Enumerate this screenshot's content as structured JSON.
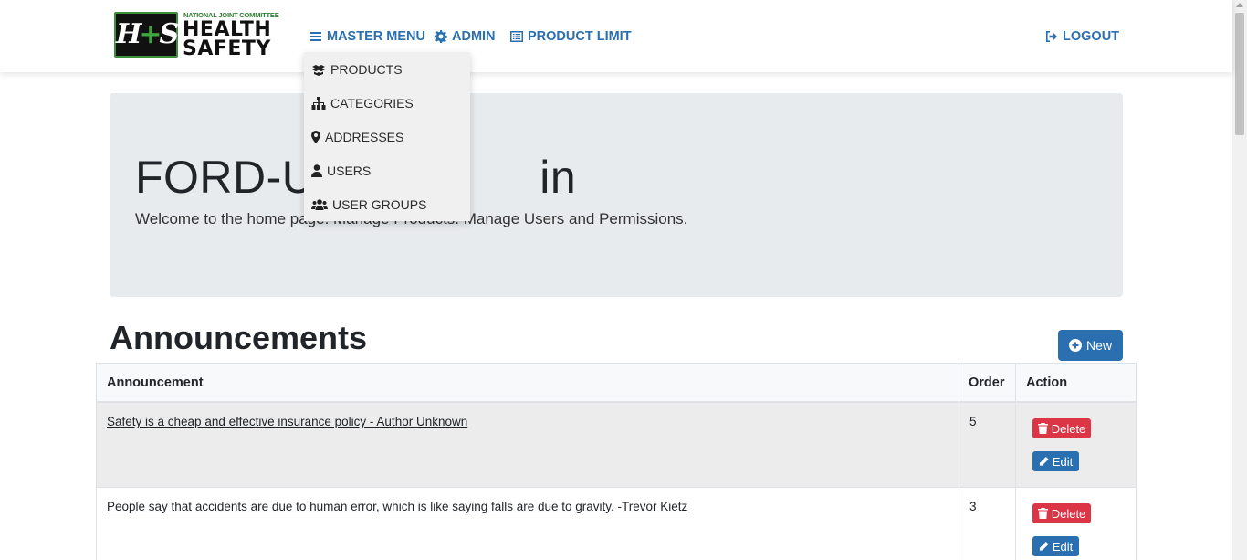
{
  "logo": {
    "small_text": "NATIONAL JOINT COMMITTEE",
    "mark_h": "H",
    "mark_plus": "+",
    "mark_s": "S",
    "line1": "HEALTH",
    "line2": "SAFETY"
  },
  "nav": {
    "master_menu": "MASTER MENU",
    "admin": "ADMIN",
    "product_limit": "PRODUCT LIMIT",
    "logout": "LOGOUT",
    "icons": {
      "master_menu": "bars-icon",
      "admin": "gear-icon",
      "product_limit": "list-alt-icon",
      "logout": "sign-out-icon"
    }
  },
  "dropdown": {
    "items": [
      {
        "label": "PRODUCTS",
        "icon": "boxes-icon"
      },
      {
        "label": "CATEGORIES",
        "icon": "sitemap-icon"
      },
      {
        "label": "ADDRESSES",
        "icon": "map-marker-icon"
      },
      {
        "label": "USERS",
        "icon": "user-icon"
      },
      {
        "label": "USER GROUPS",
        "icon": "users-icon"
      }
    ]
  },
  "jumbotron": {
    "title": "FORD-UA",
    "title_visible_end": "in",
    "lead_start": "Welcome to the home pag",
    "lead_mid": "e. Manage Products. ",
    "lead_end": "Manage Users and Permissions."
  },
  "announcements": {
    "title": "Announcements",
    "new_label": "New",
    "columns": [
      "Announcement",
      "Order",
      "Action"
    ],
    "rows": [
      {
        "text": "Safety is a cheap and effective insurance policy - Author Unknown",
        "order": "5"
      },
      {
        "text": "People say that accidents are due to human error, which is like saying falls are due to gravity. -Trevor Kietz",
        "order": "3"
      }
    ],
    "delete_label": "Delete",
    "edit_label": "Edit"
  },
  "colors": {
    "primary": "#2a6fb0",
    "danger": "#dc3545",
    "jumbotron_bg": "#e8ebee",
    "logo_green": "#3d8f3d"
  }
}
